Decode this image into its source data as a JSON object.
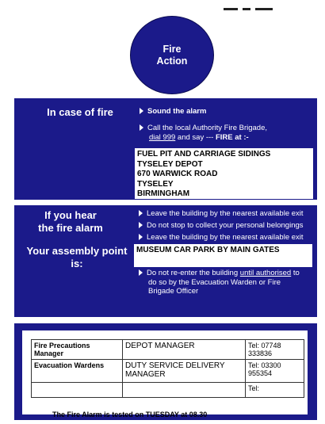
{
  "circle": {
    "line1": "Fire",
    "line2": "Action"
  },
  "fire_panel": {
    "heading": "In case of fire",
    "bullet1": "Sound the alarm",
    "bullet2_line1": "Call the local Authority Fire Brigade,",
    "bullet2_dial": "dial 999",
    "bullet2_and_say": " and say --- ",
    "bullet2_fire": "FIRE at :-",
    "address": [
      "FUEL PIT AND CARRIAGE SIDINGS",
      "TYSELEY DEPOT",
      "670 WARWICK ROAD",
      "TYSELEY",
      "BIRMINGHAM"
    ]
  },
  "alarm_panel": {
    "heading_line1": "If you hear",
    "heading_line2": "the fire alarm",
    "assembly_line1": "Your assembly point",
    "assembly_line2": "is:",
    "bullet1": "Leave the building by the nearest available exit",
    "bullet2": "Do not stop to collect your personal belongings",
    "bullet3": "Leave the building by the nearest available exit",
    "assembly_point": "MUSEUM CAR PARK BY MAIN GATES",
    "bullet4_pre": "Do not re-enter the building ",
    "bullet4_ul": "until authorised",
    "bullet4_post": " to",
    "bullet4_line2": "do so by the Evacuation Warden or Fire",
    "bullet4_line3": "Brigade Officer"
  },
  "responsibilities": {
    "rows": [
      {
        "role": "Fire Precautions Manager",
        "name": "DEPOT MANAGER",
        "tel": "Tel: 07748 333836"
      },
      {
        "role": "Evacuation Wardens",
        "name": "DUTY SERVICE DELIVERY MANAGER",
        "tel": "Tel: 03300 955354"
      },
      {
        "role": "",
        "name": "",
        "tel": "Tel:"
      }
    ],
    "footer": "The Fire Alarm is tested on TUESDAY at 08.30"
  }
}
